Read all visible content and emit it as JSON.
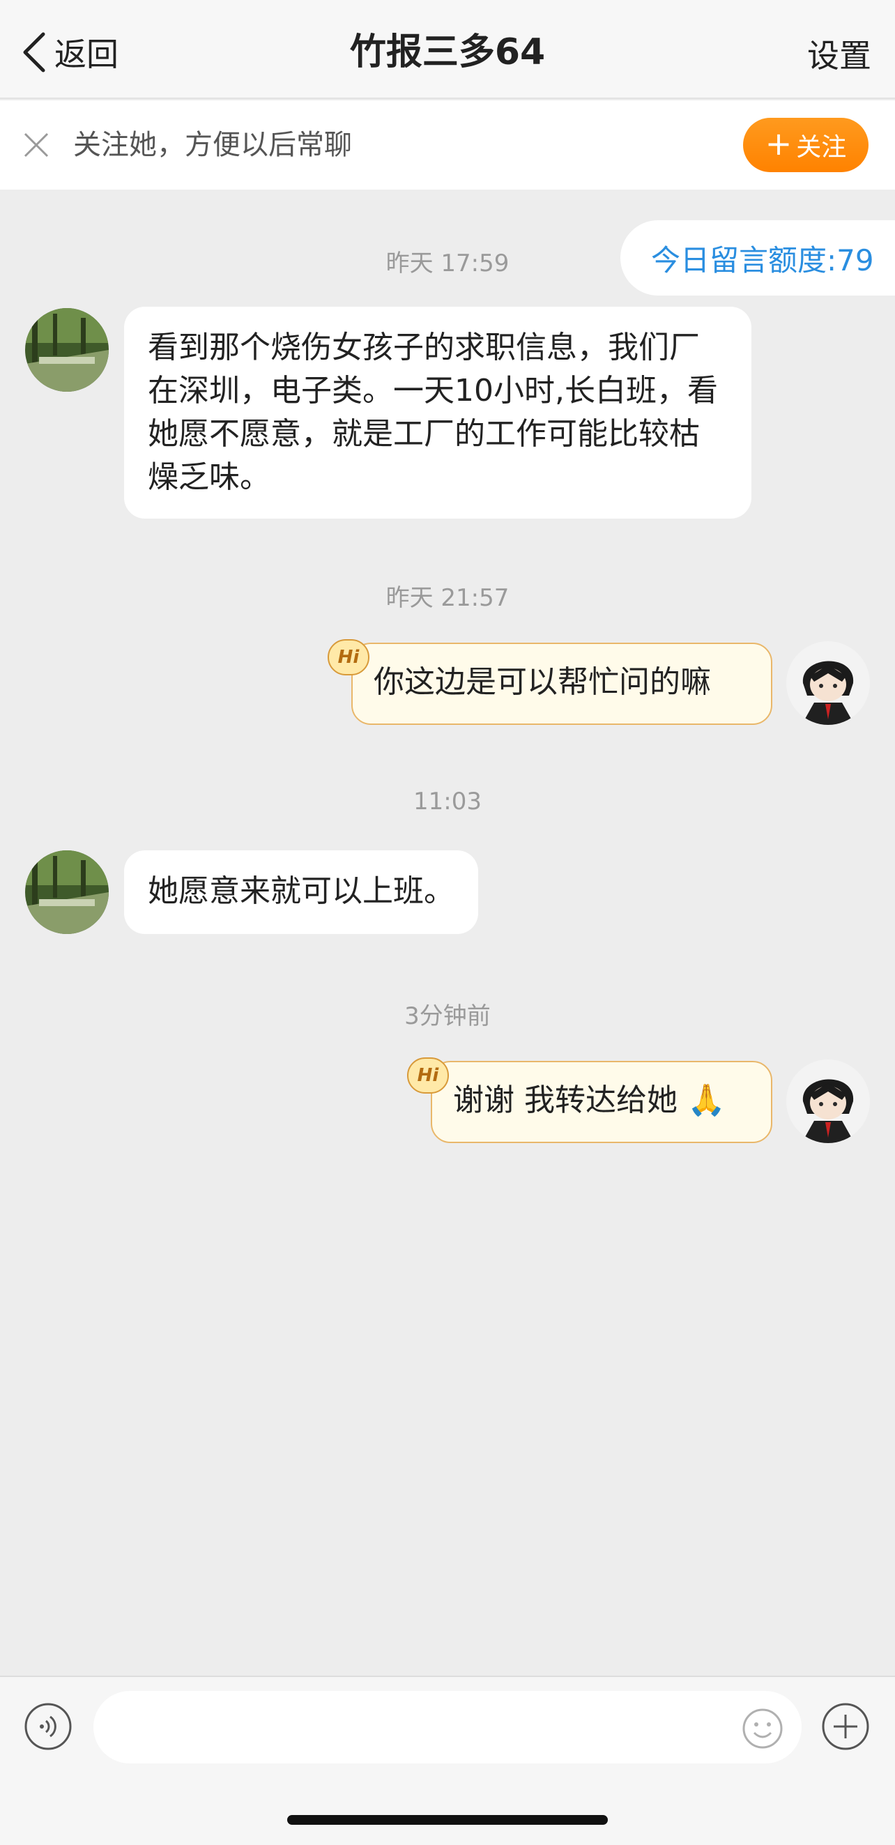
{
  "header": {
    "back_label": "返回",
    "title": "竹报三多64",
    "settings_label": "设置"
  },
  "follow_bar": {
    "text": "关注她，方便以后常聊",
    "button_label": "关注"
  },
  "quota": {
    "text": "今日留言额度:79"
  },
  "messages": [
    {
      "timestamp": "昨天 17:59",
      "side": "left",
      "text": "看到那个烧伤女孩子的求职信息，我们厂在深圳，电子类。一天10小时,长白班，看她愿不愿意，就是工厂的工作可能比较枯燥乏味。"
    },
    {
      "timestamp": "昨天 21:57",
      "side": "right",
      "badge": "Hi",
      "text": "你这边是可以帮忙问的嘛"
    },
    {
      "timestamp": "11:03",
      "side": "left",
      "text": "她愿意来就可以上班。"
    },
    {
      "timestamp": "3分钟前",
      "side": "right",
      "badge": "Hi",
      "text": "谢谢 我转达给她",
      "emoji": "🙏"
    }
  ],
  "icons": {
    "back": "chevron-left-icon",
    "close": "close-icon",
    "voice": "voice-icon",
    "emoji": "smiley-icon",
    "add": "plus-circle-icon"
  },
  "colors": {
    "accent_orange": "#ff8a00",
    "quota_blue": "#2a8ee0",
    "bubble_right_bg": "#fffbea",
    "bubble_right_border": "#e9b76a",
    "background": "#ededed"
  },
  "input": {
    "placeholder": ""
  }
}
